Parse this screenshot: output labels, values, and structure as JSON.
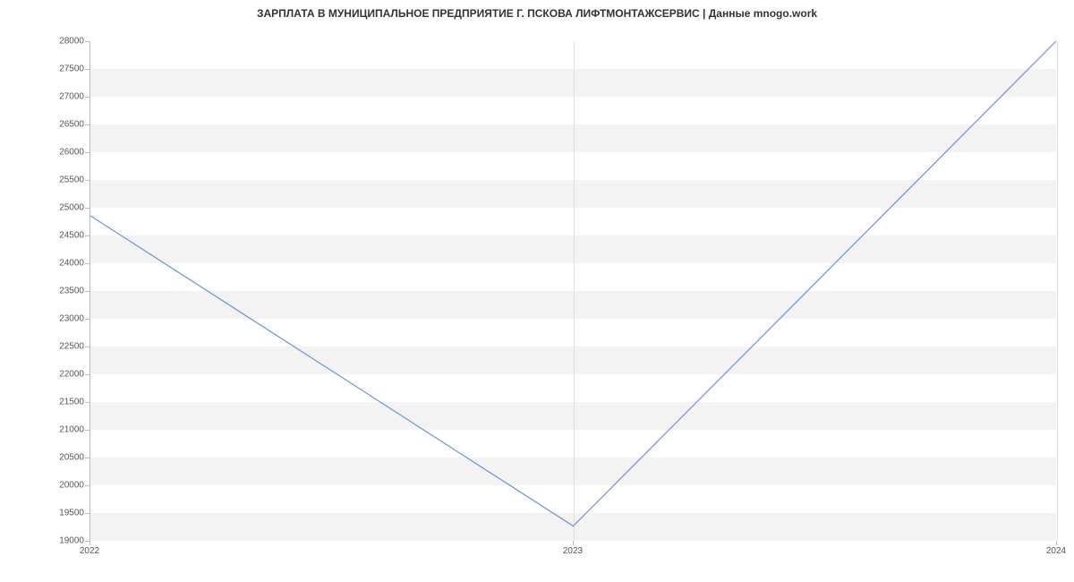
{
  "chart_data": {
    "type": "line",
    "title": "ЗАРПЛАТА В МУНИЦИПАЛЬНОЕ ПРЕДПРИЯТИЕ Г. ПСКОВА ЛИФТМОНТАЖСЕРВИС | Данные mnogo.work",
    "xlabel": "",
    "ylabel": "",
    "x_categories": [
      "2022",
      "2023",
      "2024"
    ],
    "x_indices": [
      0,
      1,
      2
    ],
    "series": [
      {
        "name": "salary",
        "color": "#6a93d4",
        "values": [
          24850,
          19250,
          28000
        ]
      }
    ],
    "y_ticks": [
      19000,
      19500,
      20000,
      20500,
      21000,
      21500,
      22000,
      22500,
      23000,
      23500,
      24000,
      24500,
      25000,
      25500,
      26000,
      26500,
      27000,
      27500,
      28000
    ],
    "ylim": [
      19000,
      28000
    ],
    "xlim": [
      0,
      2
    ],
    "grid": {
      "bands_start": 19000,
      "band_height": 500
    }
  }
}
